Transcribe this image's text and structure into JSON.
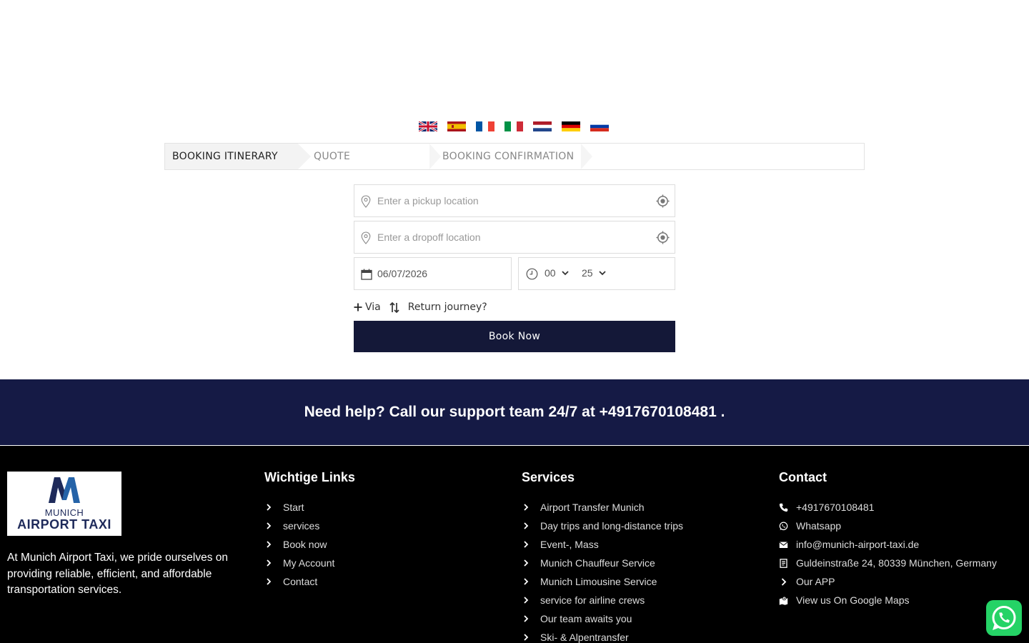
{
  "languages": [
    "English",
    "Español",
    "Français",
    "Italiano",
    "Nederlands",
    "Deutsch",
    "Русский"
  ],
  "steps": {
    "step1": "BOOKING ITINERARY",
    "step2": "QUOTE",
    "step3": "BOOKING CONFIRMATION"
  },
  "form": {
    "pickup_placeholder": "Enter a pickup location",
    "dropoff_placeholder": "Enter a dropoff location",
    "date_value": "06/07/2026",
    "hour_value": "00",
    "minute_value": "25",
    "via_label": "Via",
    "return_label": "Return journey?",
    "book_label": "Book Now"
  },
  "help": {
    "text": "Need help? Call our support team 24/7 at +4917670108481 ."
  },
  "footer": {
    "logo_sub": "MUNICH",
    "logo_name": "AIRPORT TAXI",
    "about": "At Munich Airport Taxi, we pride ourselves on providing reliable, efficient, and affordable transportation services.",
    "links_title": "Wichtige Links",
    "links": [
      "Start",
      "services",
      "Book now",
      "My Account",
      "Contact"
    ],
    "services_title": "Services",
    "services": [
      "Airport Transfer Munich",
      "Day trips and long-distance trips",
      "Event-, Mass",
      "Munich Chauffeur Service",
      "Munich Limousine Service",
      "service for airline crews",
      "Our team awaits you",
      "Ski- & Alpentransfer"
    ],
    "contact_title": "Contact",
    "contact": [
      {
        "icon": "phone-icon",
        "text": "+4917670108481"
      },
      {
        "icon": "whatsapp-icon",
        "text": "Whatsapp"
      },
      {
        "icon": "envelope-icon",
        "text": "info@munich-airport-taxi.de"
      },
      {
        "icon": "address-icon",
        "text": "Guldeinstraße 24, 80339 München, Germany"
      },
      {
        "icon": "chevron-right-icon",
        "text": "Our APP"
      },
      {
        "icon": "map-icon",
        "text": "View us On Google Maps"
      }
    ]
  },
  "colors": {
    "primary": "#141838",
    "band": "#151a45",
    "footer_bg": "#000000",
    "whatsapp": "#25d366"
  }
}
